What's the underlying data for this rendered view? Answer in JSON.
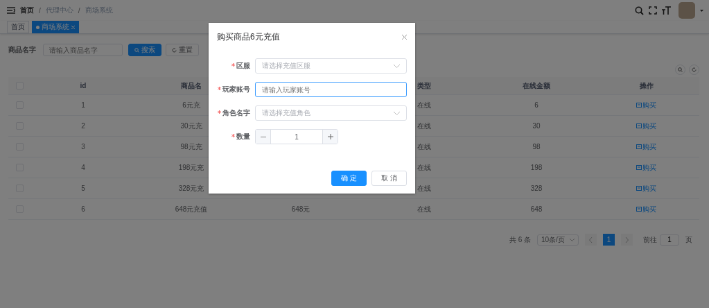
{
  "breadcrumb": {
    "separator": "/",
    "items": [
      "首页",
      "代理中心",
      "商场系统"
    ]
  },
  "tags": [
    {
      "label": "首页",
      "selected": false,
      "closable": false
    },
    {
      "label": "商场系统",
      "selected": true,
      "closable": true
    }
  ],
  "search": {
    "label": "商品名字",
    "placeholder": "请输入商品名字",
    "search_button": "搜索",
    "reset_button": "重置"
  },
  "table": {
    "header_checked": false,
    "columns": [
      "id",
      "商品名",
      "",
      "类型",
      "在线金额",
      "操作"
    ],
    "rows": [
      {
        "checked": false,
        "cells": [
          "1",
          "6元充",
          "",
          "在线",
          "6"
        ],
        "action": "购买"
      },
      {
        "checked": false,
        "cells": [
          "2",
          "30元充",
          "",
          "在线",
          "30"
        ],
        "action": "购买"
      },
      {
        "checked": false,
        "cells": [
          "3",
          "98元充",
          "",
          "在线",
          "98"
        ],
        "action": "购买"
      },
      {
        "checked": false,
        "cells": [
          "4",
          "198元充",
          "",
          "在线",
          "198"
        ],
        "action": "购买"
      },
      {
        "checked": false,
        "cells": [
          "5",
          "328元充",
          "",
          "在线",
          "328"
        ],
        "action": "购买"
      },
      {
        "checked": false,
        "cells": [
          "6",
          "648元充值",
          "648元",
          "在线",
          "648"
        ],
        "action": "购买"
      }
    ]
  },
  "pagination": {
    "total": "共 6 条",
    "page_size": "10条/页",
    "pages": [
      {
        "label": "1",
        "selected": true
      }
    ],
    "goto_label": "前往",
    "goto_value": "1",
    "goto_suffix": "页"
  },
  "dialog": {
    "title": "购买商品6元充值",
    "fields": [
      {
        "kind": "select",
        "label": "区服",
        "required": true,
        "placeholder": "请选择充值区服",
        "focused": false
      },
      {
        "kind": "input",
        "label": "玩家账号",
        "required": true,
        "placeholder": "请输入玩家账号",
        "focused": true
      },
      {
        "kind": "select",
        "label": "角色名字",
        "required": true,
        "placeholder": "请选择充值角色",
        "focused": false
      },
      {
        "kind": "number",
        "label": "数量",
        "required": true,
        "value": "1"
      }
    ],
    "confirm": "确 定",
    "cancel": "取 消"
  }
}
